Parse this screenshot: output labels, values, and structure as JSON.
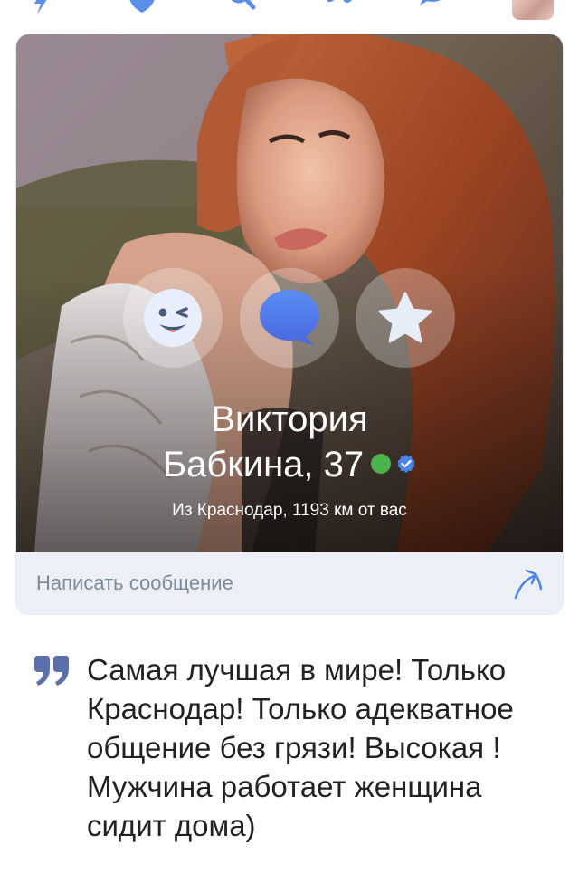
{
  "top_nav": {
    "icons": [
      "lightning-icon",
      "shield-icon",
      "search-icon",
      "megaphone-icon",
      "chat-icon"
    ],
    "avatar": "profile-avatar"
  },
  "profile": {
    "name_line1": "Виктория",
    "name_line2": "Бабкина, 37",
    "location": "Из Краснодар, 1193 км от вас",
    "online": true,
    "verified": true,
    "actions": [
      "wink-icon",
      "message-bubble-icon",
      "star-icon"
    ]
  },
  "message_bar": {
    "label": "Написать сообщение",
    "share_icon": "share-arrow-icon"
  },
  "status": {
    "quote_icon": "quote-icon",
    "text": "Самая лучшая в мире! Только Краснодар! Только адекватное общение без грязи! Высокая ! Мужчина работает женщина сидит дома)"
  },
  "colors": {
    "accent": "#4a86e8",
    "online": "#4bb34b",
    "message_bar_bg": "#ecf0f6",
    "message_bar_text": "#7e8b9c",
    "quote": "#5b6fa8"
  }
}
